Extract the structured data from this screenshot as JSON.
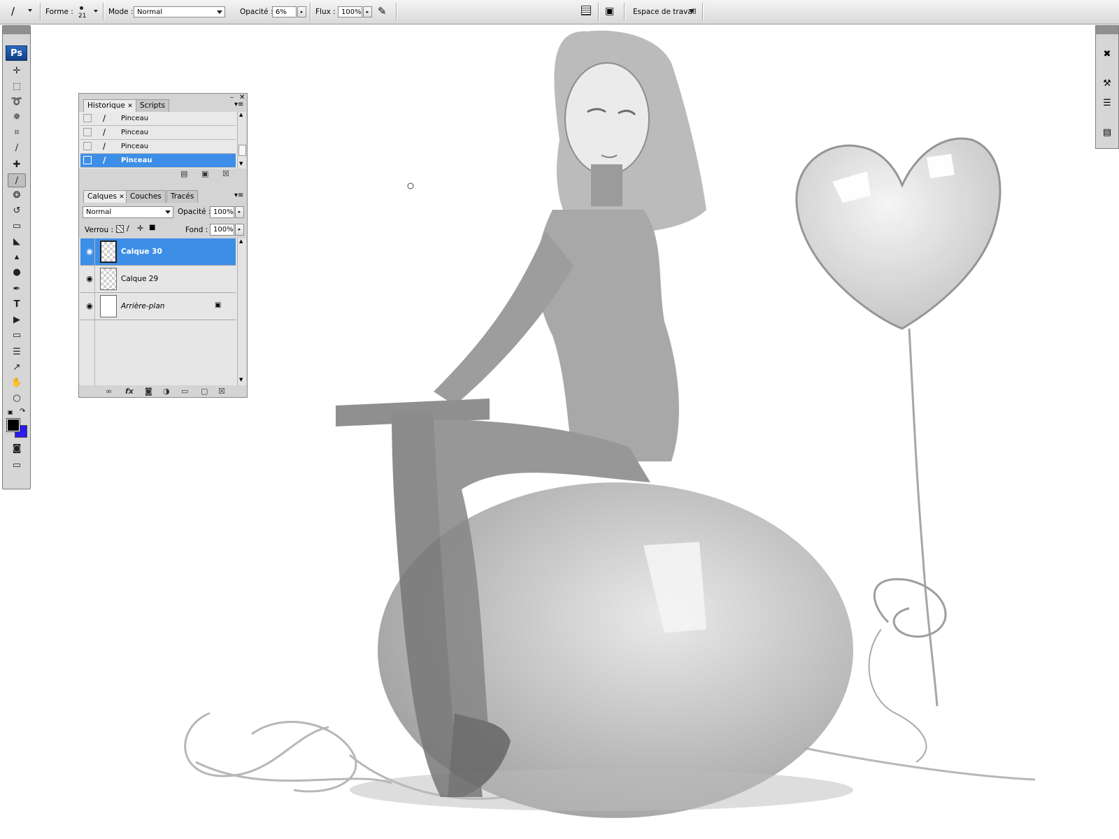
{
  "options_bar": {
    "tool_icon": "brush-icon",
    "forme_label": "Forme :",
    "brush_size": "21",
    "mode_label": "Mode :",
    "mode_value": "Normal",
    "opacity_label": "Opacité :",
    "opacity_value": "6%",
    "flux_label": "Flux :",
    "flux_value": "100%",
    "airbrush_icon": "airbrush-icon",
    "palette_icon": "palette-well-icon",
    "bridge_icon": "bridge-icon",
    "workspace_label": "Espace de travail"
  },
  "toolbox": {
    "logo": "Ps",
    "foreground_color": "#000000",
    "background_color": "#2b1cf0"
  },
  "history_panel": {
    "tabs": [
      "Historique",
      "Scripts"
    ],
    "rows": [
      {
        "label": "Pinceau"
      },
      {
        "label": "Pinceau"
      },
      {
        "label": "Pinceau"
      },
      {
        "label": "Pinceau"
      }
    ],
    "selected_index": 3
  },
  "layers_panel": {
    "tabs": [
      "Calques",
      "Couches",
      "Tracés"
    ],
    "blend_mode": "Normal",
    "opacity_label": "Opacité :",
    "opacity_value": "100%",
    "lock_label": "Verrou :",
    "fill_label": "Fond :",
    "fill_value": "100%",
    "layers": [
      {
        "name": "Calque 30",
        "visible": true,
        "selected": true
      },
      {
        "name": "Calque 29",
        "visible": true,
        "selected": false
      },
      {
        "name": "Arrière-plan",
        "visible": true,
        "selected": false,
        "locked": true
      }
    ]
  },
  "colors": {
    "selection_blue": "#3d8ee6",
    "panel_gray": "#d4d4d4"
  }
}
